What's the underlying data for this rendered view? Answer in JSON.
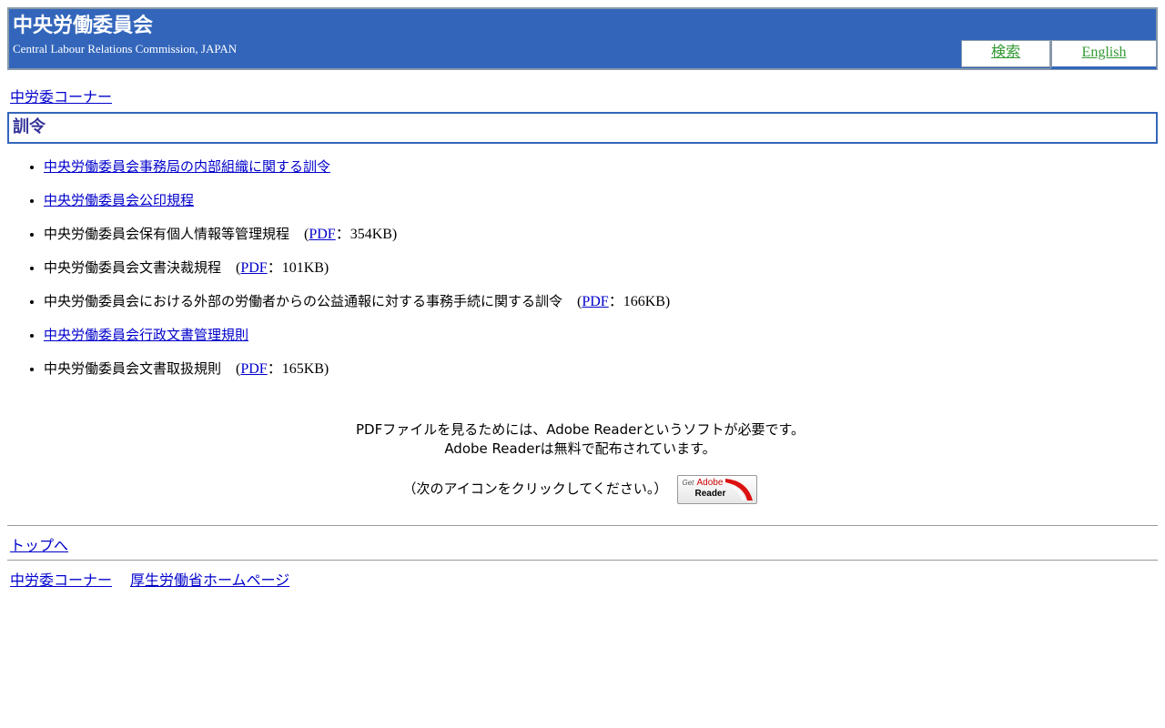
{
  "header": {
    "title": "中央労働委員会",
    "subtitle": "Central Labour Relations Commission, JAPAN",
    "nav": {
      "search_label": "検索",
      "english_label": "English"
    }
  },
  "breadcrumb": {
    "corner_label": "中労委コーナー"
  },
  "section": {
    "title": "訓令"
  },
  "documents": [
    {
      "title": "中央労働委員会事務局の内部組織に関する訓令",
      "linked": true
    },
    {
      "title": "中央労働委員会公印規程",
      "linked": true
    },
    {
      "title": "中央労働委員会保有個人情報等管理規程",
      "linked": false,
      "pdf_label": "PDF",
      "size": "：354KB)"
    },
    {
      "title": "中央労働委員会文書決裁規程",
      "linked": false,
      "pdf_label": "PDF",
      "size": "：101KB)"
    },
    {
      "title": "中央労働委員会における外部の労働者からの公益通報に対する事務手続に関する訓令",
      "linked": false,
      "pdf_label": "PDF",
      "size": "：166KB)"
    },
    {
      "title": "中央労働委員会行政文書管理規則",
      "linked": true
    },
    {
      "title": "中央労働委員会文書取扱規則",
      "linked": false,
      "pdf_label": "PDF",
      "size": "：165KB)"
    }
  ],
  "pdf_open_paren": "(",
  "notice": {
    "line1": "PDFファイルを見るためには、Adobe Readerというソフトが必要です。",
    "line2": "Adobe Readerは無料で配布されています。",
    "click_text": "（次のアイコンをクリックしてください。）",
    "badge": {
      "get": "Get",
      "brand": "Adobe",
      "product": "Reader"
    }
  },
  "footer": {
    "to_top_label": "トップへ",
    "corner_label": "中労委コーナー",
    "mhlw_label": "厚生労働省ホームページ"
  },
  "colors": {
    "header_bg": "#3366bb",
    "section_title": "#333399",
    "link": "#0000cc",
    "nav_link": "#339933"
  }
}
